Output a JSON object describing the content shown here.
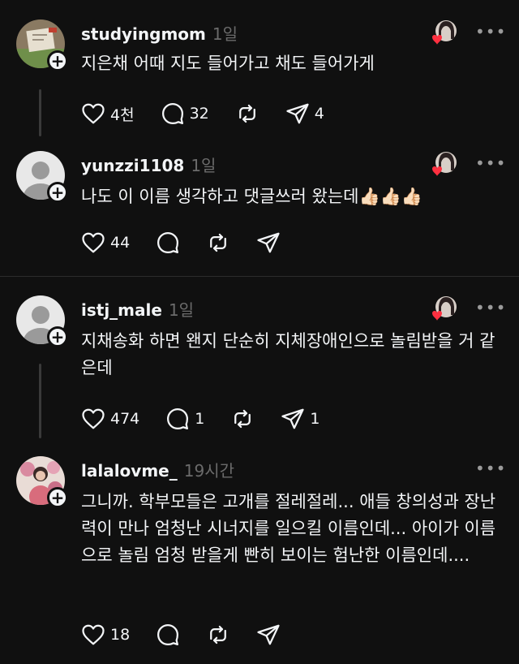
{
  "comments": [
    {
      "username": "studyingmom",
      "time": "1일",
      "text": "지은채 어때 지도 들어가고 채도 들어가게",
      "likes": "4천",
      "replies": "32",
      "reposts": "",
      "shares": "4",
      "avatar": "photo-paper-icon"
    },
    {
      "username": "yunzzi1108",
      "time": "1일",
      "text": "나도 이 이름 생각하고 댓글쓰러 왔는데👍🏻👍🏻👍🏻",
      "likes": "44",
      "replies": "",
      "reposts": "",
      "shares": "",
      "avatar": "default-avatar-icon"
    },
    {
      "username": "istj_male",
      "time": "1일",
      "text": "지채송화 하면 왠지 단순히 지체장애인으로 놀림받을 거 같은데",
      "likes": "474",
      "replies": "1",
      "reposts": "",
      "shares": "1",
      "avatar": "default-avatar-icon"
    },
    {
      "username": "lalalovme_",
      "time": "19시간",
      "text": "그니까. 학부모들은 고개를 절레절레... 애들 창의성과 장난력이 만나 엄청난 시너지를 일으킬 이름인데... 아이가 이름으로 놀림 엄청 받을게 빤히 보이는 험난한 이름인데....",
      "likes": "18",
      "replies": "",
      "reposts": "",
      "shares": "",
      "avatar": "photo-flowers-icon"
    }
  ],
  "more_label": "•••",
  "colors": {
    "background": "#101010",
    "text": "#f3f5f7",
    "muted": "#6b6b6b",
    "heart": "#ff3040"
  }
}
